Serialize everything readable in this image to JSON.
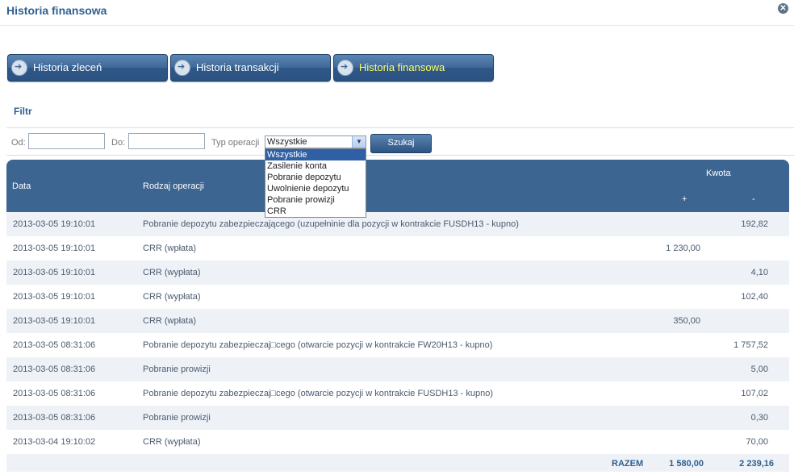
{
  "window": {
    "title": "Historia finansowa"
  },
  "tabs": [
    {
      "label": "Historia zleceń",
      "active": false
    },
    {
      "label": "Historia transakcji",
      "active": false
    },
    {
      "label": "Historia finansowa",
      "active": true
    }
  ],
  "filter": {
    "title": "Filtr",
    "od_label": "Od:",
    "od_value": "",
    "do_label": "Do:",
    "do_value": "",
    "typ_label": "Typ operacji",
    "typ_selected": "Wszystkie",
    "typ_options": [
      "Wszystkie",
      "Zasilenie konta",
      "Pobranie depozytu",
      "Uwolnienie depozytu",
      "Pobranie prowizji",
      "CRR"
    ],
    "search_label": "Szukaj"
  },
  "table": {
    "headers": {
      "date": "Data",
      "operation": "Rodzaj operacji",
      "amount": "Kwota",
      "plus": "+",
      "minus": "-"
    },
    "rows": [
      {
        "date": "2013-03-05 19:10:01",
        "operation": "Pobranie depozytu zabezpieczającego (uzupełninie dla pozycji w kontrakcie FUSDH13 - kupno)",
        "plus": "",
        "minus": "192,82"
      },
      {
        "date": "2013-03-05 19:10:01",
        "operation": "CRR (wpłata)",
        "plus": "1 230,00",
        "minus": ""
      },
      {
        "date": "2013-03-05 19:10:01",
        "operation": "CRR (wypłata)",
        "plus": "",
        "minus": "4,10"
      },
      {
        "date": "2013-03-05 19:10:01",
        "operation": "CRR (wypłata)",
        "plus": "",
        "minus": "102,40"
      },
      {
        "date": "2013-03-05 19:10:01",
        "operation": "CRR (wpłata)",
        "plus": "350,00",
        "minus": ""
      },
      {
        "date": "2013-03-05 08:31:06",
        "operation": "Pobranie depozytu zabezpieczaj□cego (otwarcie pozycji w kontrakcie FW20H13 - kupno)",
        "plus": "",
        "minus": "1 757,52"
      },
      {
        "date": "2013-03-05 08:31:06",
        "operation": "Pobranie prowizji",
        "plus": "",
        "minus": "5,00"
      },
      {
        "date": "2013-03-05 08:31:06",
        "operation": "Pobranie depozytu zabezpieczaj□cego (otwarcie pozycji w kontrakcie FUSDH13 - kupno)",
        "plus": "",
        "minus": "107,02"
      },
      {
        "date": "2013-03-05 08:31:06",
        "operation": "Pobranie prowizji",
        "plus": "",
        "minus": "0,30"
      },
      {
        "date": "2013-03-04 19:10:02",
        "operation": "CRR (wypłata)",
        "plus": "",
        "minus": "70,00"
      }
    ],
    "total": {
      "label": "RAZEM",
      "plus": "1 580,00",
      "minus": "2 239,16"
    }
  },
  "colors": {
    "header_bg": "#3c6591",
    "title": "#2f5f8f",
    "active_tab_text": "#ffff66"
  }
}
